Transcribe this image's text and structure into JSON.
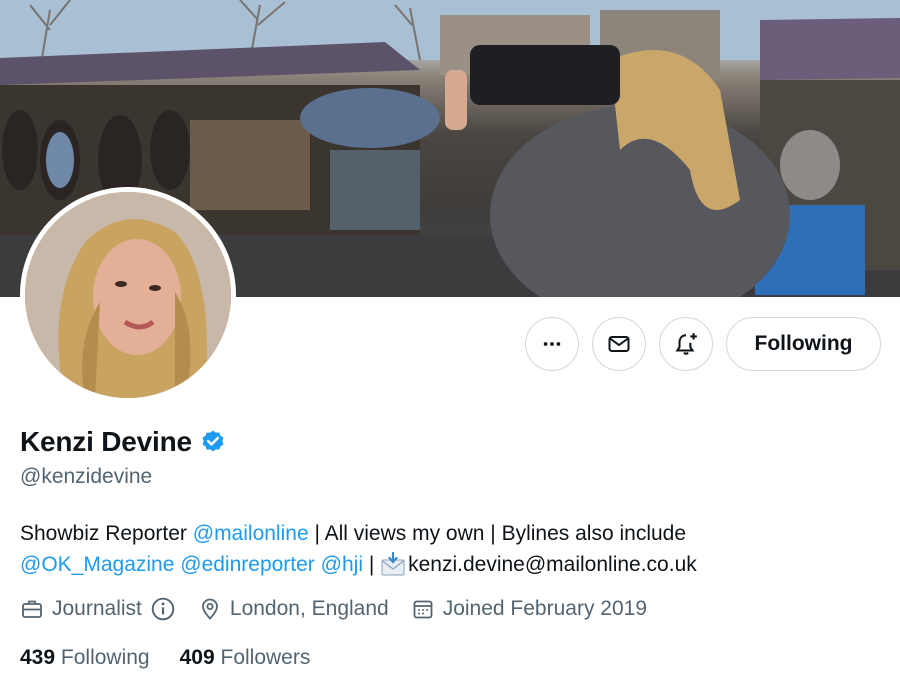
{
  "banner": {
    "alt": ""
  },
  "actions": {
    "more_icon": "more-horizontal-icon",
    "message_icon": "envelope-icon",
    "notify_icon": "bell-plus-icon",
    "following_label": "Following"
  },
  "profile": {
    "name": "Kenzi Devine",
    "verified_icon": "verified-badge-icon",
    "handle": "@kenzidevine",
    "bio": {
      "part1": "Showbiz Reporter ",
      "mention1": "@mailonline",
      "part2": " | All views my own | Bylines also include",
      "mention2": "@OK_Magazine",
      "mention3": "@edinreporter",
      "mention4": "@hji",
      "part3": " | ",
      "email": "kenzi.devine@mailonline.co.uk"
    },
    "meta": {
      "category": "Journalist",
      "location": "London, England",
      "joined": "Joined February 2019"
    },
    "stats": {
      "following_count": "439",
      "following_label": "Following",
      "followers_count": "409",
      "followers_label": "Followers"
    }
  },
  "colors": {
    "accent": "#1d9bf0",
    "muted": "#536471",
    "text": "#0f1419",
    "border": "#cfd9de"
  }
}
